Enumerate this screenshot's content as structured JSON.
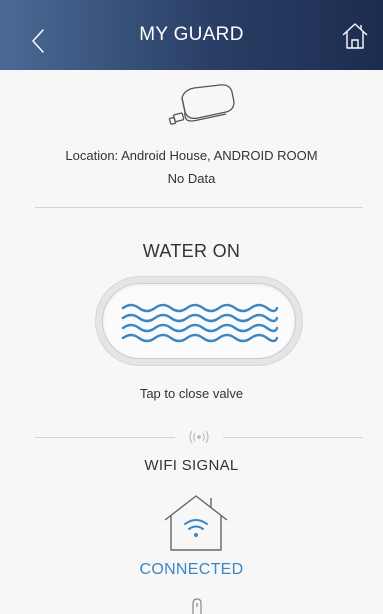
{
  "header": {
    "title": "MY GUARD",
    "back_icon": "chevron-left-icon",
    "home_icon": "home-icon"
  },
  "device": {
    "icon": "water-guard-device-icon",
    "location": "Location: Android House, ANDROID ROOM",
    "status": "No Data"
  },
  "water": {
    "title": "WATER ON",
    "valve_icon": "water-waves-icon",
    "hint": "Tap to close valve",
    "wave_color": "#3b86c4"
  },
  "wifi": {
    "divider_icon": "wifi-signal-icon",
    "title": "WIFI SIGNAL",
    "house_icon": "house-wifi-icon",
    "status": "CONNECTED",
    "status_color": "#3b86c4",
    "bottom_icon": "unknown-partial-icon"
  }
}
